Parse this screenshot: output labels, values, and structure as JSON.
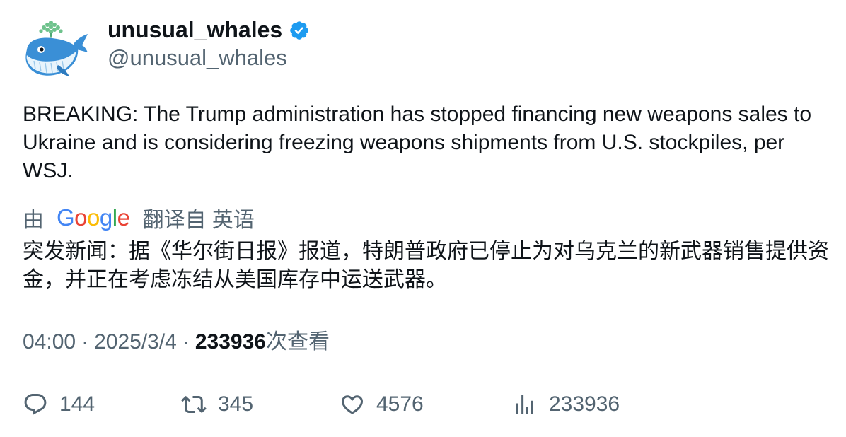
{
  "author": {
    "display_name": "unusual_whales",
    "handle": "@unusual_whales",
    "verified_color": "#1d9bf0",
    "avatar_icon": "whale-logo-icon"
  },
  "tweet": {
    "text": "BREAKING: The Trump administration has stopped financing new weapons sales to Ukraine and is considering freezing weapons shipments from U.S. stockpiles, per WSJ."
  },
  "translation": {
    "prefix": "由",
    "provider_letters": [
      "G",
      "o",
      "o",
      "g",
      "l",
      "e"
    ],
    "provider_colors": [
      "#4285F4",
      "#EA4335",
      "#FBBC05",
      "#4285F4",
      "#34A853",
      "#EA4335"
    ],
    "suffix": "翻译自 英语",
    "text": "突发新闻：据《华尔街日报》报道，特朗普政府已停止为对乌克兰的新武器销售提供资金，并正在考虑冻结从美国库存中运送武器。"
  },
  "meta": {
    "time": "04:00",
    "separator": "·",
    "date": "2025/3/4",
    "views_count": "233936",
    "views_label": "次查看"
  },
  "actions": {
    "replies": "144",
    "retweets": "345",
    "likes": "4576",
    "views": "233936"
  },
  "colors": {
    "text_primary": "#0f1419",
    "text_secondary": "#536471"
  }
}
